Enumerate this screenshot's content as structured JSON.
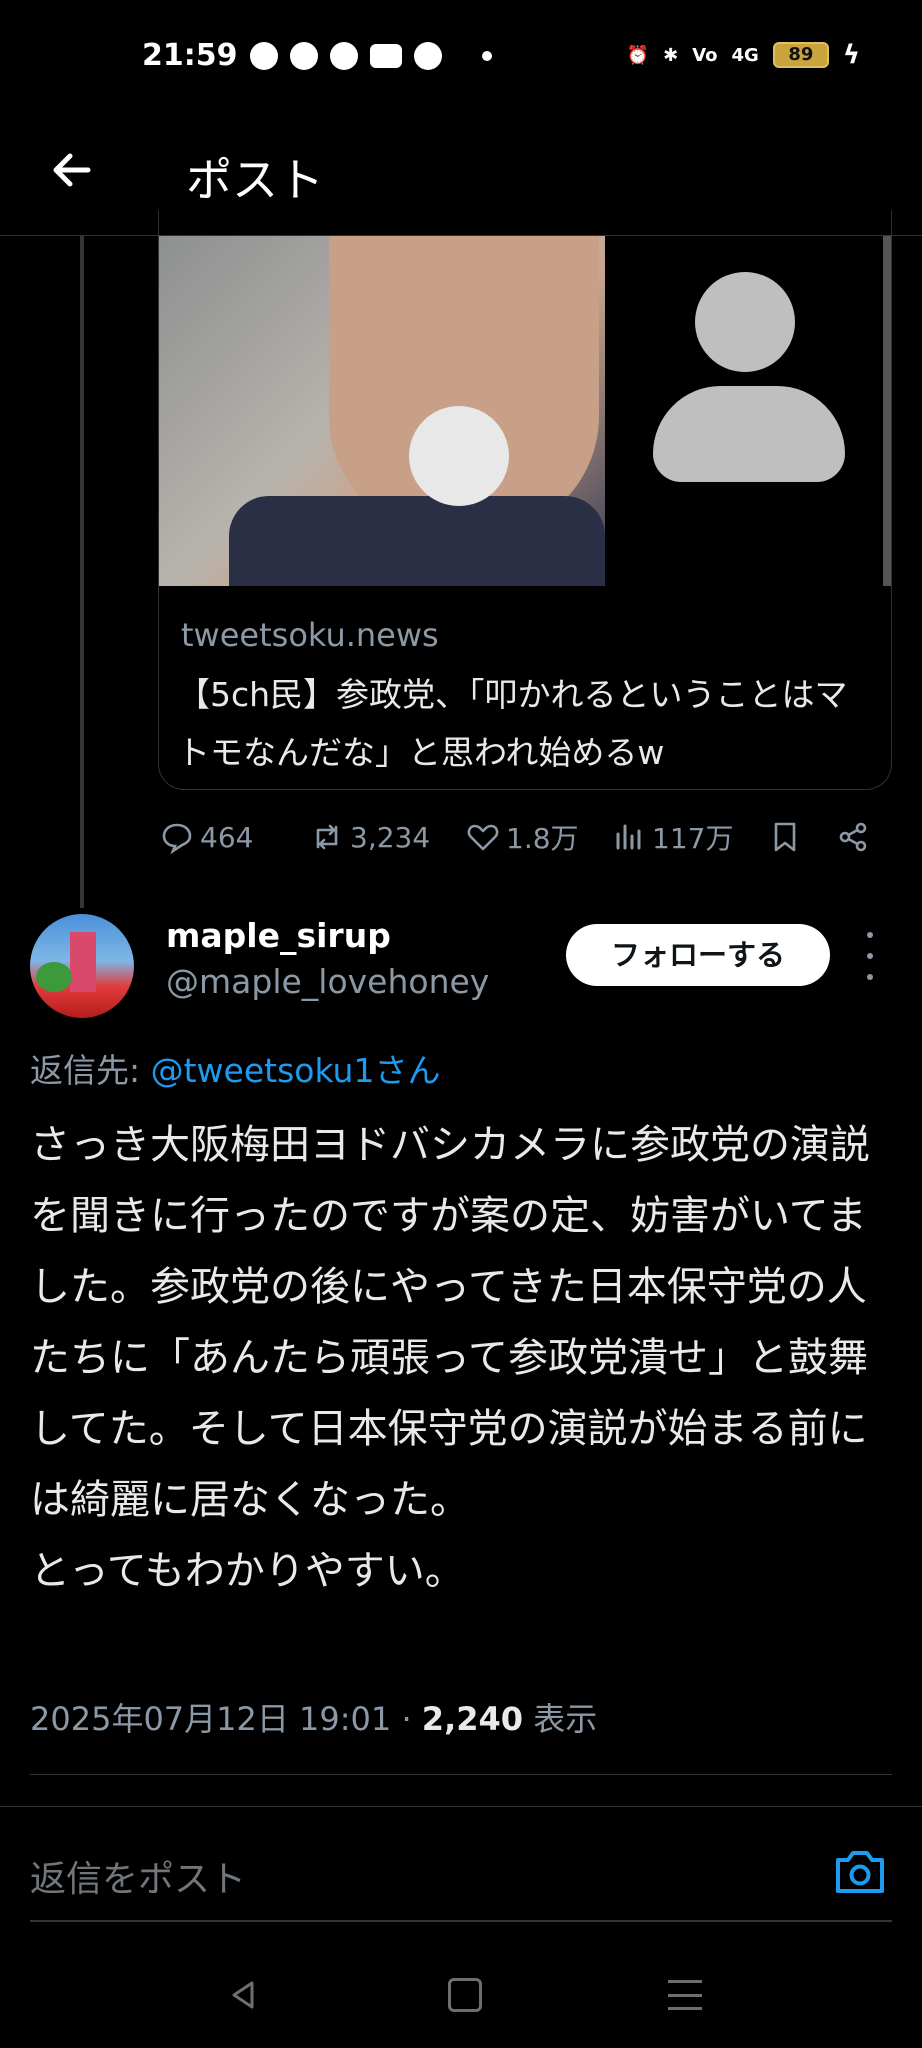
{
  "status_bar": {
    "time": "21:59",
    "battery": "89",
    "network": "4G",
    "icons_left": [
      "facebook-icon",
      "threads-icon",
      "messenger-icon",
      "youtube-icon",
      "weather-icon"
    ],
    "icons_right": [
      "alarm-icon",
      "bluetooth-icon",
      "volte-icon",
      "signal-icon",
      "battery-icon",
      "charging-icon"
    ]
  },
  "header": {
    "title": "ポスト"
  },
  "link_card": {
    "domain": "tweetsoku.news",
    "title": "【5ch民】参政党、「叩かれるということはマトモなんだな」と思われ始めるw"
  },
  "actions": {
    "replies": "464",
    "reposts": "3,234",
    "likes": "1.8万",
    "views": "117万"
  },
  "tweet": {
    "display_name": "maple_sirup",
    "handle": "@maple_lovehoney",
    "follow_label": "フォローする",
    "reply_prefix": "返信先: ",
    "reply_mention": "@tweetsoku1さん",
    "body": "さっき大阪梅田ヨドバシカメラに参政党の演説を聞きに行ったのですが案の定、妨害がいてました。参政党の後にやってきた日本保守党の人たちに「あんたら頑張って参政党潰せ」と鼓舞してた。そして日本保守党の演説が始まる前には綺麗に居なくなった。\nとってもわかりやすい。",
    "timestamp": "2025年07月12日 19:01",
    "separator": " · ",
    "view_count": "2,240",
    "view_label": " 表示"
  },
  "reply_box": {
    "placeholder": "返信をポスト"
  },
  "colors": {
    "background": "#000000",
    "text": "#e7e9ea",
    "secondary": "#8b98a5",
    "accent": "#1d9bf0"
  }
}
